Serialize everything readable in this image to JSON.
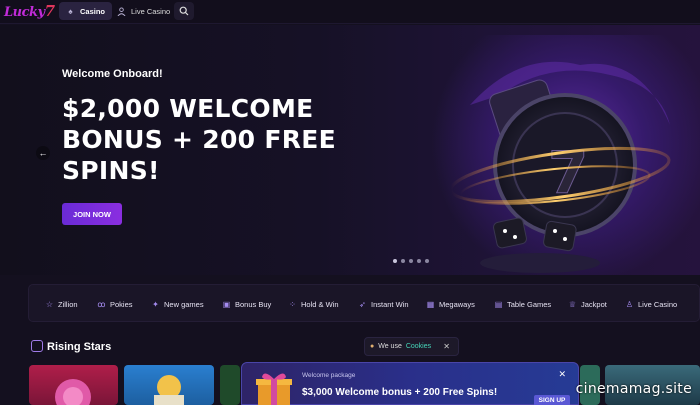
{
  "brand": {
    "logo_text": "Lucky",
    "logo_seven": "7"
  },
  "nav": {
    "tabs": [
      {
        "label": "Casino",
        "icon": "spade-icon",
        "active": true
      },
      {
        "label": "Live Casino",
        "icon": "dealer-icon",
        "active": false
      }
    ],
    "search_icon": "search-icon"
  },
  "hero": {
    "subtitle": "Welcome Onboard!",
    "title": "$2,000 WELCOME BONUS + 200 FREE SPINS!",
    "cta_label": "JOIN NOW",
    "slide_count": 5,
    "active_slide": 1
  },
  "categories": [
    {
      "label": "Zillion",
      "icon": "star-icon"
    },
    {
      "label": "Pokies",
      "icon": "cherry-icon"
    },
    {
      "label": "New games",
      "icon": "sparkle-icon"
    },
    {
      "label": "Bonus Buy",
      "icon": "gift-icon"
    },
    {
      "label": "Hold & Win",
      "icon": "coins-icon"
    },
    {
      "label": "Instant Win",
      "icon": "rocket-icon"
    },
    {
      "label": "Megaways",
      "icon": "grid-icon"
    },
    {
      "label": "Table Games",
      "icon": "cards-icon"
    },
    {
      "label": "Jackpot",
      "icon": "trophy-icon"
    },
    {
      "label": "Live Casino",
      "icon": "dealer-icon"
    }
  ],
  "rising_stars": {
    "title": "Rising Stars"
  },
  "cookie_notice": {
    "prefix": "We use",
    "link": "Cookies"
  },
  "promo": {
    "tag": "Welcome package",
    "text": "$3,000 Welcome bonus + 200 Free Spins!",
    "button": "SIGN UP"
  },
  "watermark": "cinemamag.site",
  "colors": {
    "accent": "#7b2ee0",
    "link": "#46d6b9",
    "background": "#14101f"
  }
}
